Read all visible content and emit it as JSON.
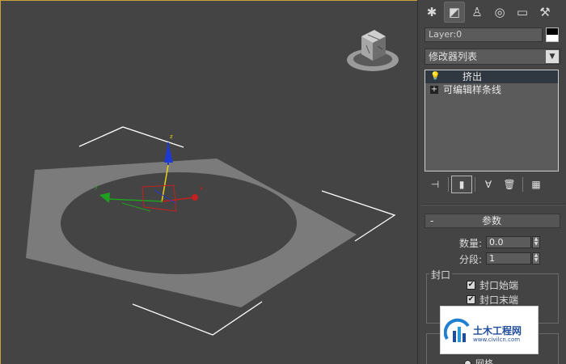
{
  "panel": {
    "tabs": [
      {
        "icon": "create-icon",
        "glyph": "✱"
      },
      {
        "icon": "modify-icon",
        "glyph": "◩"
      },
      {
        "icon": "hierarchy-icon",
        "glyph": "♙"
      },
      {
        "icon": "motion-icon",
        "glyph": "◎"
      },
      {
        "icon": "display-icon",
        "glyph": "▭"
      },
      {
        "icon": "utilities-icon",
        "glyph": "⚒"
      }
    ],
    "object_name": "Layer:0",
    "modifier_list_label": "修改器列表",
    "stack": [
      {
        "label": "挤出",
        "selected": true
      },
      {
        "label": "可编辑样条线",
        "selected": false
      }
    ],
    "stack_tools": [
      "pin-stack-icon",
      "show-end-result-icon",
      "make-unique-icon",
      "remove-modifier-icon",
      "configure-modifier-sets-icon"
    ]
  },
  "parameters": {
    "rollout_title": "参数",
    "amount_label": "数量:",
    "amount_value": "0.0",
    "segments_label": "分段:",
    "segments_value": "1",
    "capping_group": "封口",
    "cap_start_label": "封口始端",
    "cap_start_checked": true,
    "cap_end_label": "封口末端",
    "cap_end_checked": true,
    "grid_label": "网格"
  },
  "watermark": {
    "text": "土木工程网",
    "url": "www.civilcn.com"
  },
  "colors": {
    "viewport_bg": "#444444",
    "shape_fill": "#7b7b7b",
    "axis_x": "#c42020",
    "axis_y": "#20a020",
    "axis_z": "#1e3ad0",
    "selection_bracket": "#ffffff",
    "viewport_border": "#c9a13a"
  }
}
